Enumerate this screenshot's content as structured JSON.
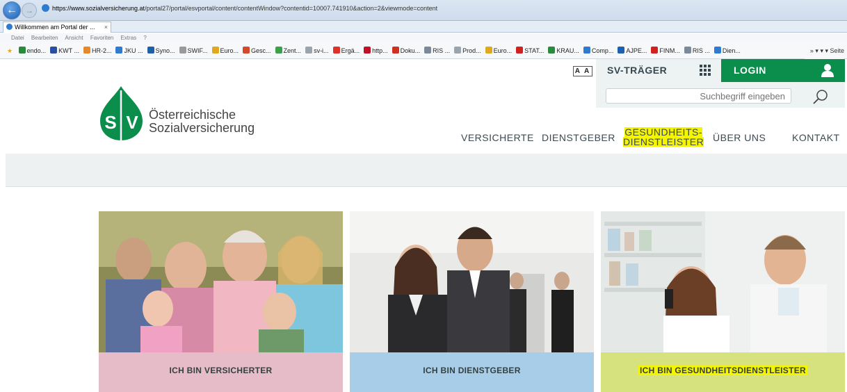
{
  "browser": {
    "url_host": "https://www.sozialversicherung.at",
    "url_path": "/portal27/portal/esvportal/content/contentWindow?contentid=10007.741910&action=2&viewmode=content",
    "tab_title": "Willkommen am Portal der ...",
    "tab_close": "×",
    "menu": [
      "Datei",
      "Bearbeiten",
      "Ansicht",
      "Favoriten",
      "Extras",
      "?"
    ],
    "favorites": [
      {
        "label": "endo...",
        "color": "#2a8a3c"
      },
      {
        "label": "KWT ...",
        "color": "#2b4fa0"
      },
      {
        "label": "HR-2...",
        "color": "#e58a2a"
      },
      {
        "label": "JKU ...",
        "color": "#2e7bd0"
      },
      {
        "label": "Syno...",
        "color": "#1f5fa8"
      },
      {
        "label": "SWIF...",
        "color": "#9a9a9a"
      },
      {
        "label": "Euro...",
        "color": "#e0a820"
      },
      {
        "label": "Gesc...",
        "color": "#d24a2a"
      },
      {
        "label": "Zent...",
        "color": "#3aa04a"
      },
      {
        "label": "sv-i...",
        "color": "#9aa4ad"
      },
      {
        "label": "Ergä...",
        "color": "#e0302a"
      },
      {
        "label": "http...",
        "color": "#c0102a"
      },
      {
        "label": "Doku...",
        "color": "#d03020"
      },
      {
        "label": "RIS ...",
        "color": "#7a8a9a"
      },
      {
        "label": "Prod...",
        "color": "#9aa4ad"
      },
      {
        "label": "Euro...",
        "color": "#e0a820"
      },
      {
        "label": "STAT...",
        "color": "#d02020"
      },
      {
        "label": "KRAU...",
        "color": "#2a8a3c"
      },
      {
        "label": "Comp...",
        "color": "#2e7bd0"
      },
      {
        "label": "AJPE...",
        "color": "#1e60b0"
      },
      {
        "label": "FINM...",
        "color": "#d02020"
      },
      {
        "label": "RIS ...",
        "color": "#7a8a9a"
      },
      {
        "label": "Dien...",
        "color": "#2e7bd0"
      }
    ],
    "toolbar_right": "»  ▾  ▾  ▾  Seite"
  },
  "header": {
    "font_size_toggle": "A A",
    "sv_traeger": "SV-TRÄGER",
    "login": "LOGIN",
    "search_placeholder": "Suchbegriff eingeben",
    "logo_line1": "Österreichische",
    "logo_line2": "Sozialversicherung",
    "brand_color": "#0b8d4b"
  },
  "nav": {
    "versicherte": "VERSICHERTE",
    "dienstgeber": "DIENSTGEBER",
    "gesundheit_line1": "GESUNDHEITS-",
    "gesundheit_line2": "DIENSTLEISTER",
    "ueber_uns": "ÜBER UNS",
    "kontakt": "KONTAKT",
    "highlight_color": "#f5f500"
  },
  "cards": [
    {
      "label": "ICH BIN VERSICHERTER",
      "color": "#e5bcc8",
      "image": "family-photo"
    },
    {
      "label": "ICH BIN DIENSTGEBER",
      "color": "#a8cde8",
      "image": "business-people-photo"
    },
    {
      "label": "ICH BIN GESUNDHEITSDIENSTLEISTER",
      "color": "#d6e27e",
      "image": "pharmacy-staff-photo"
    }
  ]
}
